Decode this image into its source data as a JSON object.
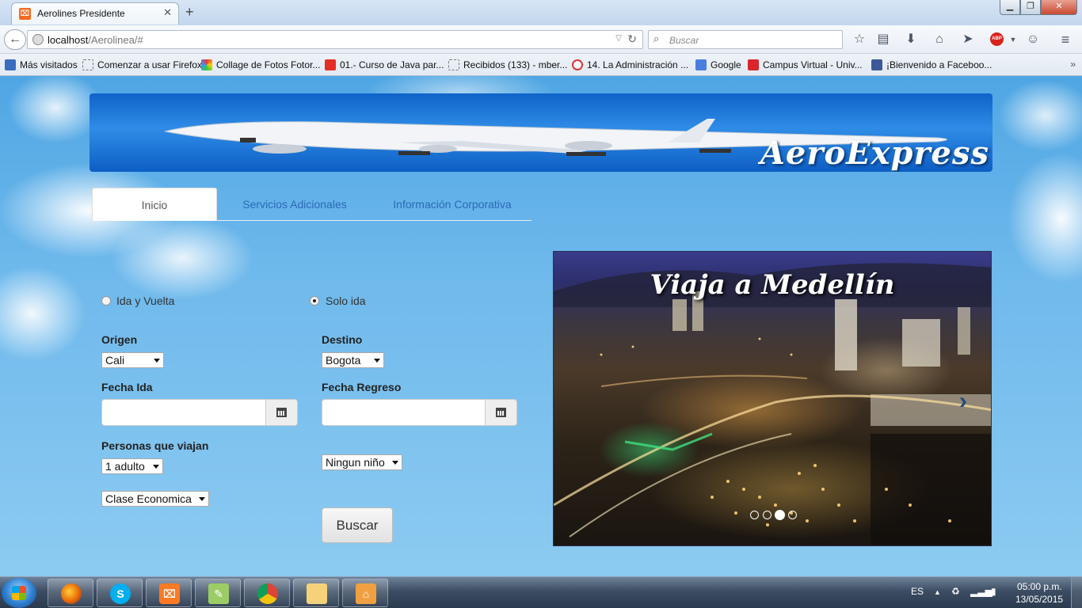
{
  "browser": {
    "tab_title": "Aerolines Presidente",
    "url_host": "localhost",
    "url_path": "/Aerolinea/#",
    "search_placeholder": "Buscar",
    "bookmarks": [
      "Más visitados",
      "Comenzar a usar Firefox",
      "Collage de Fotos Fotor...",
      "01.- Curso de Java par...",
      "Recibidos (133) - mber...",
      "14. La Administración ...",
      "Google",
      "Campus Virtual - Univ...",
      "¡Bienvenido a Faceboo..."
    ]
  },
  "site": {
    "brand": "AeroExpress",
    "nav_tabs": [
      "Inicio",
      "Servicios Adicionales",
      "Información Corporativa"
    ],
    "active_tab": "Inicio"
  },
  "form": {
    "trip_type": {
      "round_trip_label": "Ida y Vuelta",
      "one_way_label": "Solo ida",
      "selected": "Solo ida"
    },
    "origin_label": "Origen",
    "origin_value": "Cali",
    "destination_label": "Destino",
    "destination_value": "Bogota",
    "departure_label": "Fecha Ida",
    "departure_value": "",
    "return_label": "Fecha Regreso",
    "return_value": "",
    "passengers_label": "Personas que viajan",
    "adults_value": "1 adulto",
    "children_value": "Ningun niño",
    "class_value": "Clase Economica",
    "search_button": "Buscar"
  },
  "carousel": {
    "caption": "Viaja a Medellín",
    "slide_count": 4,
    "active_index": 2
  },
  "taskbar": {
    "language": "ES",
    "time": "05:00 p.m.",
    "date": "13/05/2015"
  },
  "colors": {
    "banner_blue": "#1a73d9",
    "link_blue": "#2a6ab8",
    "page_sky": "#6fb9ec"
  }
}
